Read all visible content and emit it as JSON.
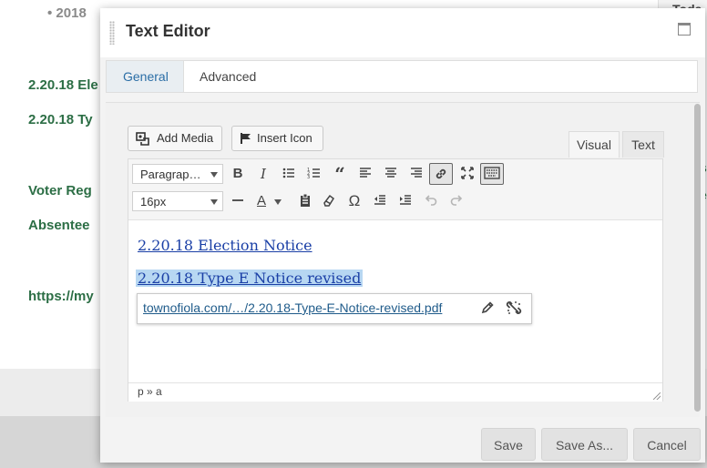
{
  "background": {
    "bullet": "2018",
    "links": [
      "2.20.18 Ele",
      "2.20.18 Ty",
      "Voter Reg",
      "Absentee",
      "https://my"
    ],
    "right_col_title": "Toda",
    "right_col_fragments": [
      "s",
      "e",
      "r"
    ]
  },
  "modal": {
    "title": "Text Editor",
    "tabs": [
      {
        "label": "General",
        "active": true
      },
      {
        "label": "Advanced",
        "active": false
      }
    ],
    "media_buttons": {
      "add_media": "Add Media",
      "insert_icon": "Insert Icon"
    },
    "view_tabs": {
      "visual": "Visual",
      "text": "Text"
    },
    "toolbar": {
      "format_select": "Paragrap…",
      "font_size_select": "16px",
      "row1_icons": [
        "bold-icon",
        "italic-icon",
        "bulleted-list-icon",
        "numbered-list-icon",
        "blockquote-icon",
        "align-left-icon",
        "align-center-icon",
        "align-right-icon",
        "insert-link-icon",
        "fullscreen-icon",
        "toolbar-toggle-icon"
      ],
      "row2_icons": [
        "horizontal-line-icon",
        "text-color-icon",
        "paste-text-icon",
        "clear-formatting-icon",
        "special-character-icon",
        "outdent-icon",
        "indent-icon",
        "undo-icon",
        "redo-icon"
      ],
      "bold_glyph": "B",
      "italic_glyph": "I",
      "text_color_glyph": "A",
      "omega_glyph": "Ω"
    },
    "document": {
      "link1": "2.20.18 Election Notice",
      "link2": "2.20.18 Type E Notice revised"
    },
    "link_popup": {
      "url": "townofiola.com/…/2.20.18-Type-E-Notice-revised.pdf"
    },
    "status_path": "p » a",
    "footer": {
      "save": "Save",
      "save_as": "Save As...",
      "cancel": "Cancel"
    }
  }
}
